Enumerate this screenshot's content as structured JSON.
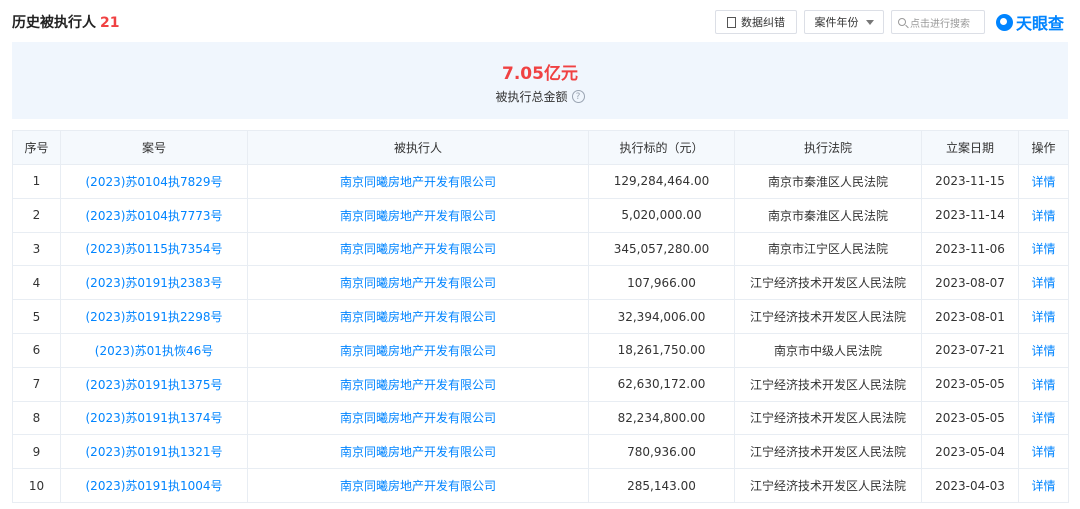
{
  "header": {
    "title": "历史被执行人",
    "count": "21",
    "correct_btn": "数据纠错",
    "year_btn": "案件年份",
    "search_placeholder": "点击进行搜索",
    "logo_text": "天眼查",
    "search_icon": "search-icon",
    "accent_color": "#0084ff",
    "highlight_color": "#f04142"
  },
  "summary": {
    "amount": "7.05亿元",
    "label": "被执行总金额",
    "help": "?"
  },
  "table": {
    "columns": [
      "序号",
      "案号",
      "被执行人",
      "执行标的（元）",
      "执行法院",
      "立案日期",
      "操作"
    ],
    "rows": [
      [
        "1",
        "(2023)苏0104执7829号",
        "南京同曦房地产开发有限公司",
        "129,284,464.00",
        "南京市秦淮区人民法院",
        "2023-11-15",
        "详情"
      ],
      [
        "2",
        "(2023)苏0104执7773号",
        "南京同曦房地产开发有限公司",
        "5,020,000.00",
        "南京市秦淮区人民法院",
        "2023-11-14",
        "详情"
      ],
      [
        "3",
        "(2023)苏0115执7354号",
        "南京同曦房地产开发有限公司",
        "345,057,280.00",
        "南京市江宁区人民法院",
        "2023-11-06",
        "详情"
      ],
      [
        "4",
        "(2023)苏0191执2383号",
        "南京同曦房地产开发有限公司",
        "107,966.00",
        "江宁经济技术开发区人民法院",
        "2023-08-07",
        "详情"
      ],
      [
        "5",
        "(2023)苏0191执2298号",
        "南京同曦房地产开发有限公司",
        "32,394,006.00",
        "江宁经济技术开发区人民法院",
        "2023-08-01",
        "详情"
      ],
      [
        "6",
        "(2023)苏01执恢46号",
        "南京同曦房地产开发有限公司",
        "18,261,750.00",
        "南京市中级人民法院",
        "2023-07-21",
        "详情"
      ],
      [
        "7",
        "(2023)苏0191执1375号",
        "南京同曦房地产开发有限公司",
        "62,630,172.00",
        "江宁经济技术开发区人民法院",
        "2023-05-05",
        "详情"
      ],
      [
        "8",
        "(2023)苏0191执1374号",
        "南京同曦房地产开发有限公司",
        "82,234,800.00",
        "江宁经济技术开发区人民法院",
        "2023-05-05",
        "详情"
      ],
      [
        "9",
        "(2023)苏0191执1321号",
        "南京同曦房地产开发有限公司",
        "780,936.00",
        "江宁经济技术开发区人民法院",
        "2023-05-04",
        "详情"
      ],
      [
        "10",
        "(2023)苏0191执1004号",
        "南京同曦房地产开发有限公司",
        "285,143.00",
        "江宁经济技术开发区人民法院",
        "2023-04-03",
        "详情"
      ]
    ]
  }
}
